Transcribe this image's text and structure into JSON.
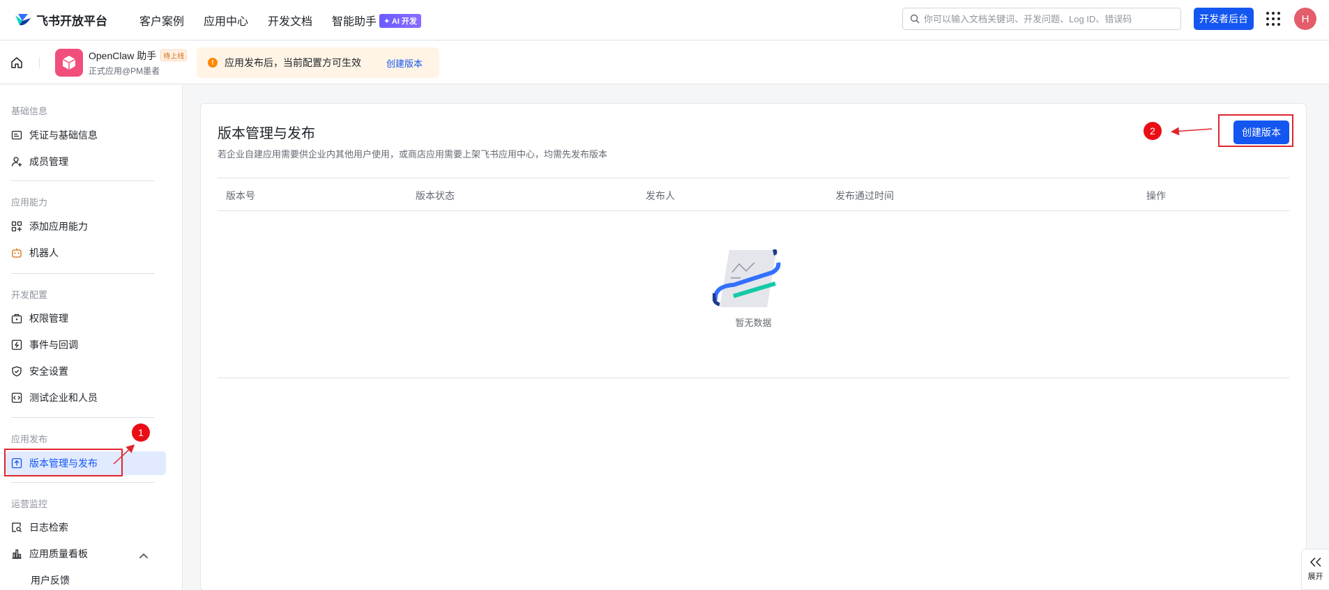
{
  "header": {
    "logo_text": "飞书开放平台",
    "nav": [
      "客户案例",
      "应用中心",
      "开发文档",
      "智能助手"
    ],
    "ai_badge": "✦ AI 开发",
    "search_placeholder": "你可以输入文档关键词、开发问题、Log ID、错误码",
    "dev_console": "开发者后台",
    "avatar": "H"
  },
  "app": {
    "name": "OpenClaw 助手",
    "status": "待上线",
    "subtitle": "正式应用@PM墨者",
    "notice": "应用发布后，当前配置方可生效",
    "notice_link": "创建版本"
  },
  "sidebar": {
    "groups": [
      "基础信息",
      "应用能力",
      "开发配置",
      "应用发布",
      "运营监控"
    ],
    "items": [
      {
        "label": "凭证与基础信息"
      },
      {
        "label": "成员管理"
      },
      {
        "label": "添加应用能力"
      },
      {
        "label": "机器人"
      },
      {
        "label": "权限管理"
      },
      {
        "label": "事件与回调"
      },
      {
        "label": "安全设置"
      },
      {
        "label": "测试企业和人员"
      },
      {
        "label": "版本管理与发布"
      },
      {
        "label": "日志检索"
      },
      {
        "label": "应用质量看板"
      },
      {
        "label": "用户反馈"
      }
    ]
  },
  "main": {
    "title": "版本管理与发布",
    "description": "若企业自建应用需要供企业内其他用户使用，或商店应用需要上架飞书应用中心，均需先发布版本",
    "create_button": "创建版本",
    "columns": [
      "版本号",
      "版本状态",
      "发布人",
      "发布通过时间",
      "操作"
    ],
    "empty_text": "暂无数据"
  },
  "annotations": {
    "step1": "1",
    "step2": "2"
  },
  "expand_label": "展开",
  "colors": {
    "primary": "#1456f0",
    "annotation": "#e0252b",
    "notice_bg": "#fff4e5",
    "active_bg": "#e1eaff"
  }
}
